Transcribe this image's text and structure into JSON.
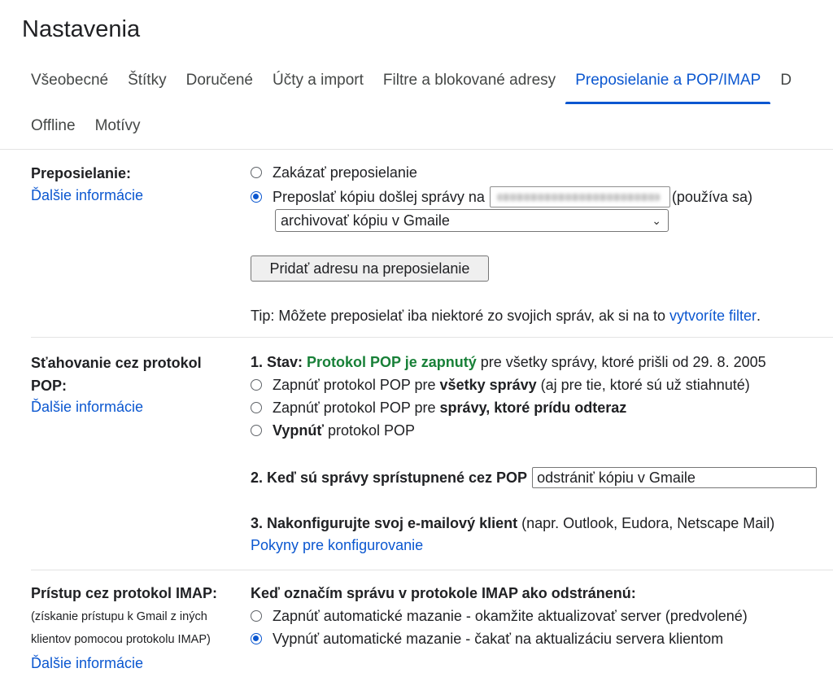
{
  "title": "Nastavenia",
  "tabs_row1": [
    "Všeobecné",
    "Štítky",
    "Doručené",
    "Účty a import",
    "Filtre a blokované adresy",
    "Preposielanie a POP/IMAP",
    "D"
  ],
  "tabs_row2": [
    "Offline",
    "Motívy"
  ],
  "active_tab": "Preposielanie a POP/IMAP",
  "forwarding": {
    "label": "Preposielanie:",
    "more_info": "Ďalšie informácie",
    "disable_option": "Zakázať preposielanie",
    "forward_option": "Preposlať kópiu došlej správy na",
    "in_use": "(používa sa)",
    "action_select": "archivovať kópiu v Gmaile",
    "add_button": "Pridať adresu na preposielanie",
    "tip_text": "Tip: Môžete preposielať iba niektoré zo svojich správ, ak si na to",
    "tip_link": "vytvoríte filter",
    "tip_end": "."
  },
  "pop": {
    "label_line1": "Sťahovanie cez protokol",
    "label_line2": "POP:",
    "more_info": "Ďalšie informácie",
    "status_prefix": "1. Stav:",
    "status_value": "Protokol POP je zapnutý",
    "status_suffix": "pre všetky správy, ktoré prišli od 29. 8. 2005",
    "opt1_pre": "Zapnúť protokol POP pre",
    "opt1_bold": "všetky správy",
    "opt1_post": "(aj pre tie, ktoré sú už stiahnuté)",
    "opt2_pre": "Zapnúť protokol POP pre",
    "opt2_bold": "správy, ktoré prídu odteraz",
    "opt3_bold": "Vypnúť",
    "opt3_post": "protokol POP",
    "when_accessed": "2. Keď sú správy sprístupnené cez POP",
    "when_select": "odstrániť kópiu v Gmaile",
    "configure_bold": "3. Nakonfigurujte svoj e-mailový klient",
    "configure_rest": "(napr. Outlook, Eudora, Netscape Mail)",
    "instructions_link": "Pokyny pre konfigurovanie"
  },
  "imap": {
    "label": "Prístup cez protokol IMAP:",
    "sub1": "(získanie prístupu k Gmail z iných",
    "sub2": "klientov pomocou protokolu IMAP)",
    "more_info": "Ďalšie informácie",
    "heading": "Keď označím správu v protokole IMAP ako odstránenú:",
    "opt_auto_on": "Zapnúť automatické mazanie - okamžite aktualizovať server (predvolené)",
    "opt_auto_off": "Vypnúť automatické mazanie - čakať na aktualizáciu servera klientom"
  }
}
